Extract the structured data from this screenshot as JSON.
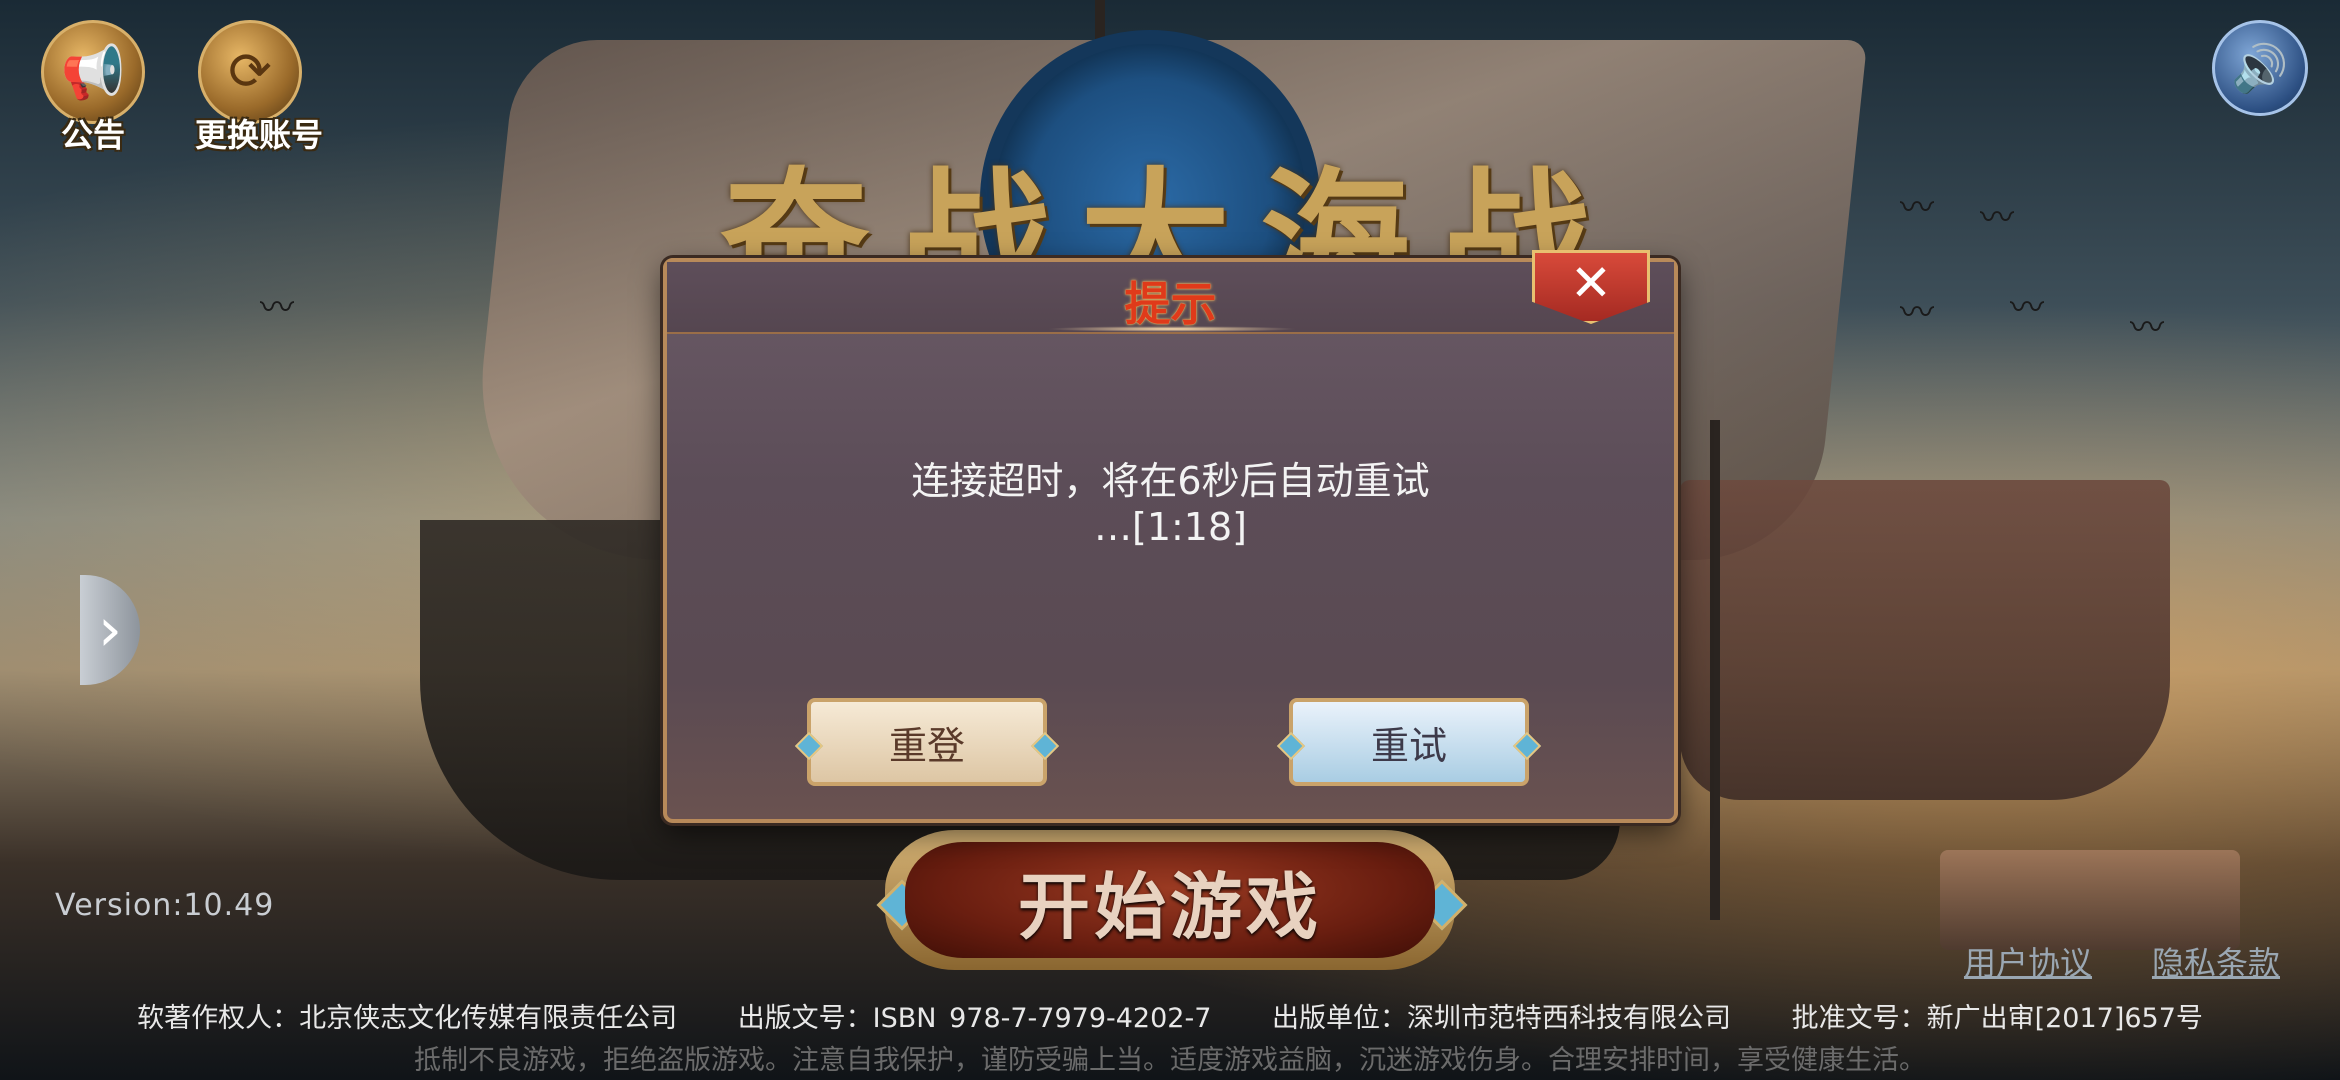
{
  "top_bar": {
    "announcement_label": "公告",
    "switch_account_label": "更换账号"
  },
  "logo": {
    "text": "奋战大海战"
  },
  "dialog": {
    "title": "提示",
    "message_line1": "连接超时，将在6秒后自动重试",
    "message_line2": "…[1:18]",
    "relogin_label": "重登",
    "retry_label": "重试"
  },
  "start_button": {
    "label": "开始游戏"
  },
  "version": "Version:10.49",
  "links": {
    "user_agreement": "用户协议",
    "privacy_policy": "隐私条款"
  },
  "footer": {
    "copyright_owner": "软著作权人：北京侠志文化传媒有限责任公司",
    "publication_no": "出版文号：ISBN 978-7-7979-4202-7",
    "publisher": "出版单位：深圳市范特西科技有限公司",
    "approval_no": "批准文号：新广出审[2017]657号",
    "health_notice": "抵制不良游戏，拒绝盗版游戏。注意自我保护，谨防受骗上当。适度游戏益脑，沉迷游戏伤身。合理安排时间，享受健康生活。"
  },
  "icons": {
    "announcement": "megaphone-icon",
    "switch_account": "refresh-icon",
    "sound": "speaker-icon",
    "side": "chevron-right-icon",
    "close": "close-icon"
  }
}
